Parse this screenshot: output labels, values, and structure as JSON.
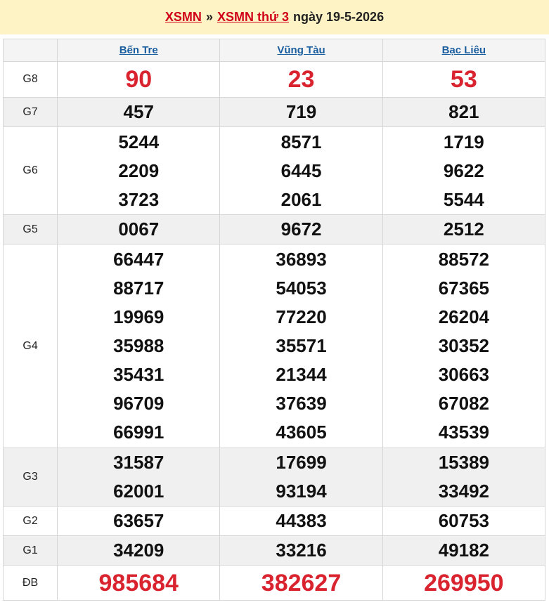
{
  "header": {
    "link1": "XSMN",
    "separator": "»",
    "link2": "XSMN thứ 3",
    "date_text": "ngày 19-5-2026"
  },
  "provinces": [
    "Bến Tre",
    "Vũng Tàu",
    "Bạc Liêu"
  ],
  "prizes": [
    {
      "label": "G8",
      "values": [
        [
          "90"
        ],
        [
          "23"
        ],
        [
          "53"
        ]
      ]
    },
    {
      "label": "G7",
      "values": [
        [
          "457"
        ],
        [
          "719"
        ],
        [
          "821"
        ]
      ]
    },
    {
      "label": "G6",
      "values": [
        [
          "5244",
          "2209",
          "3723"
        ],
        [
          "8571",
          "6445",
          "2061"
        ],
        [
          "1719",
          "9622",
          "5544"
        ]
      ]
    },
    {
      "label": "G5",
      "values": [
        [
          "0067"
        ],
        [
          "9672"
        ],
        [
          "2512"
        ]
      ]
    },
    {
      "label": "G4",
      "values": [
        [
          "66447",
          "88717",
          "19969",
          "35988",
          "35431",
          "96709",
          "66991"
        ],
        [
          "36893",
          "54053",
          "77220",
          "35571",
          "21344",
          "37639",
          "43605"
        ],
        [
          "88572",
          "67365",
          "26204",
          "30352",
          "30663",
          "67082",
          "43539"
        ]
      ]
    },
    {
      "label": "G3",
      "values": [
        [
          "31587",
          "62001"
        ],
        [
          "17699",
          "93194"
        ],
        [
          "15389",
          "33492"
        ]
      ]
    },
    {
      "label": "G2",
      "values": [
        [
          "63657"
        ],
        [
          "44383"
        ],
        [
          "60753"
        ]
      ]
    },
    {
      "label": "G1",
      "values": [
        [
          "34209"
        ],
        [
          "33216"
        ],
        [
          "49182"
        ]
      ]
    },
    {
      "label": "ĐB",
      "values": [
        [
          "985684"
        ],
        [
          "382627"
        ],
        [
          "269950"
        ]
      ]
    }
  ],
  "colors": {
    "header_bg": "#fdf3c5",
    "accent_red": "#d9232e",
    "link_blue": "#1a5e9f",
    "shade_row": "#f0f0f0"
  }
}
